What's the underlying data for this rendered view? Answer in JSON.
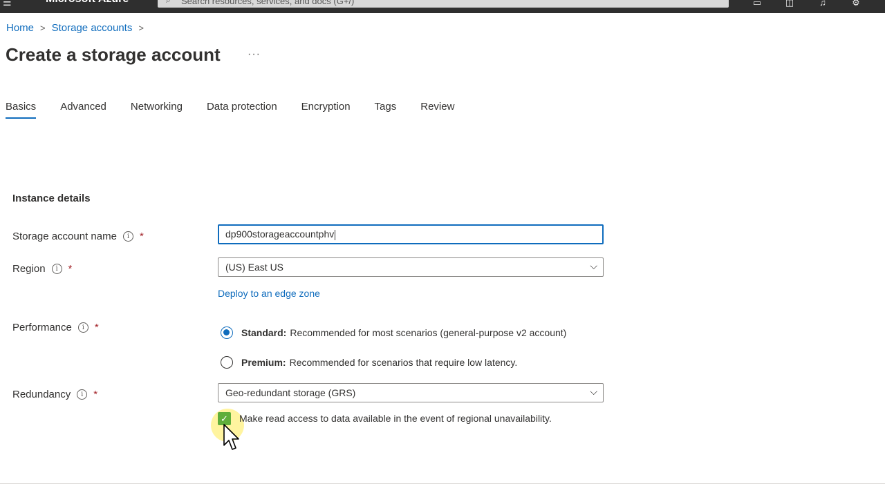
{
  "topbar": {
    "brand": "Microsoft Azure",
    "search_placeholder": "Search resources, services, and docs (G+/)",
    "icons": [
      "menu-icon",
      "search-icon",
      "cloud-shell-icon",
      "directory-icon",
      "notifications-icon",
      "settings-icon"
    ]
  },
  "breadcrumb": {
    "items": [
      "Home",
      "Storage accounts"
    ],
    "separator": ">"
  },
  "page": {
    "title": "Create a storage account",
    "more": "···"
  },
  "tabs": [
    {
      "label": "Basics",
      "active": true
    },
    {
      "label": "Advanced"
    },
    {
      "label": "Networking"
    },
    {
      "label": "Data protection"
    },
    {
      "label": "Encryption"
    },
    {
      "label": "Tags"
    },
    {
      "label": "Review"
    }
  ],
  "instance_details": {
    "title": "Instance details",
    "required_mark": "*",
    "storage_account_name": {
      "label": "Storage account name",
      "value": "dp900storageaccountphv"
    },
    "region": {
      "label": "Region",
      "value": "(US) East US",
      "edge_zone_link": "Deploy to an edge zone"
    },
    "performance": {
      "label": "Performance",
      "options": [
        {
          "name": "Standard:",
          "desc": "Recommended for most scenarios (general-purpose v2 account)",
          "selected": true
        },
        {
          "name": "Premium:",
          "desc": "Recommended for scenarios that require low latency.",
          "selected": false
        }
      ]
    },
    "redundancy": {
      "label": "Redundancy",
      "value": "Geo-redundant storage (GRS)",
      "read_access_checkbox": {
        "label": "Make read access to data available in the event of regional unavailability.",
        "checked": true
      }
    }
  },
  "colors": {
    "accent": "#0f6cbd",
    "topbar": "#2f2f2f",
    "checkbox": "#5fae3b",
    "required": "#a4262c"
  }
}
